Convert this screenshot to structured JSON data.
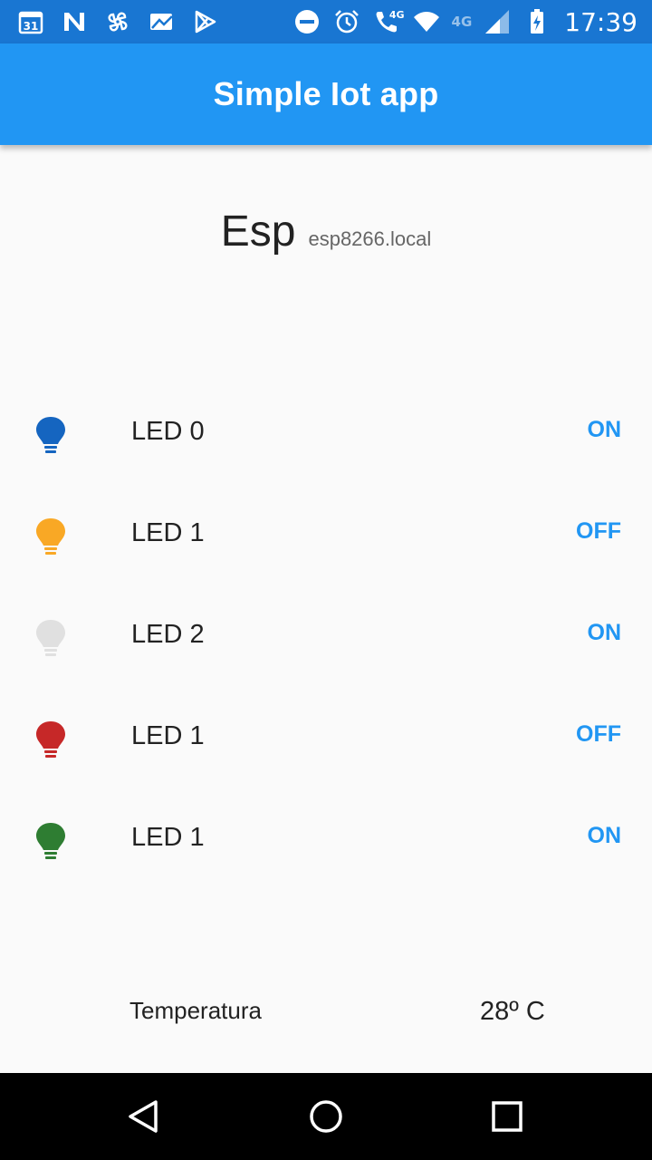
{
  "status_bar": {
    "time": "17:39",
    "network_label_1": "4G",
    "network_label_2": "4G",
    "left_icons": [
      "calendar-icon",
      "n-notification-icon",
      "pinwheel-icon",
      "photo-icon",
      "play-store-icon"
    ],
    "right_icons": [
      "do-not-disturb-icon",
      "alarm-icon",
      "wifi-calling-icon",
      "wifi-icon",
      "signal-icon",
      "battery-charging-icon"
    ]
  },
  "app_bar": {
    "title": "Simple Iot app"
  },
  "device": {
    "name": "Esp",
    "host": "esp8266.local"
  },
  "leds": [
    {
      "label": "LED 0",
      "button": "ON",
      "color": "#1565c0"
    },
    {
      "label": "LED 1",
      "button": "OFF",
      "color": "#f9a825"
    },
    {
      "label": "LED 2",
      "button": "ON",
      "color": "#e0e0e0"
    },
    {
      "label": "LED 1",
      "button": "OFF",
      "color": "#c62828"
    },
    {
      "label": "LED 1",
      "button": "ON",
      "color": "#2e7d32"
    }
  ],
  "temperature": {
    "label": "Temperatura",
    "value": "28º C"
  },
  "colors": {
    "status_bar": "#1976d2",
    "app_bar": "#2196f3",
    "accent": "#2196f3",
    "background": "#fafafa"
  }
}
